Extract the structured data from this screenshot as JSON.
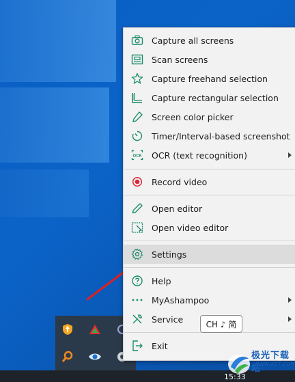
{
  "menu": {
    "items": [
      {
        "label": "Capture all screens",
        "icon": "camera-icon"
      },
      {
        "label": "Scan screens",
        "icon": "scan-screens-icon"
      },
      {
        "label": "Capture freehand selection",
        "icon": "freehand-star-icon"
      },
      {
        "label": "Capture rectangular selection",
        "icon": "ruler-icon"
      },
      {
        "label": "Screen color picker",
        "icon": "eyedropper-icon"
      },
      {
        "label": "Timer/Interval-based screenshot",
        "icon": "timer-icon"
      },
      {
        "label": "OCR (text recognition)",
        "icon": "ocr-icon",
        "submenu": true
      },
      {
        "label": "Record video",
        "icon": "record-icon"
      },
      {
        "label": "Open editor",
        "icon": "pencil-icon"
      },
      {
        "label": "Open video editor",
        "icon": "video-editor-icon"
      },
      {
        "label": "Settings",
        "icon": "gear-icon",
        "hovered": true
      },
      {
        "label": "Help",
        "icon": "help-icon"
      },
      {
        "label": "MyAshampoo",
        "icon": "dots-icon",
        "submenu": true
      },
      {
        "label": "Service",
        "icon": "tools-icon",
        "submenu": true
      },
      {
        "label": "Exit",
        "icon": "exit-icon"
      }
    ],
    "ocr_icon_text": "OCR"
  },
  "ime": {
    "text": "CH ♪ 简"
  },
  "taskbar": {
    "clock": "15:33"
  },
  "watermark": {
    "name": "极光下载站",
    "url": "www.xz7.com"
  },
  "colors": {
    "record": "#e0253a",
    "teal_icon": "#1a8a6a",
    "hover": "#dcdcdc",
    "arrow": "#e02020"
  }
}
